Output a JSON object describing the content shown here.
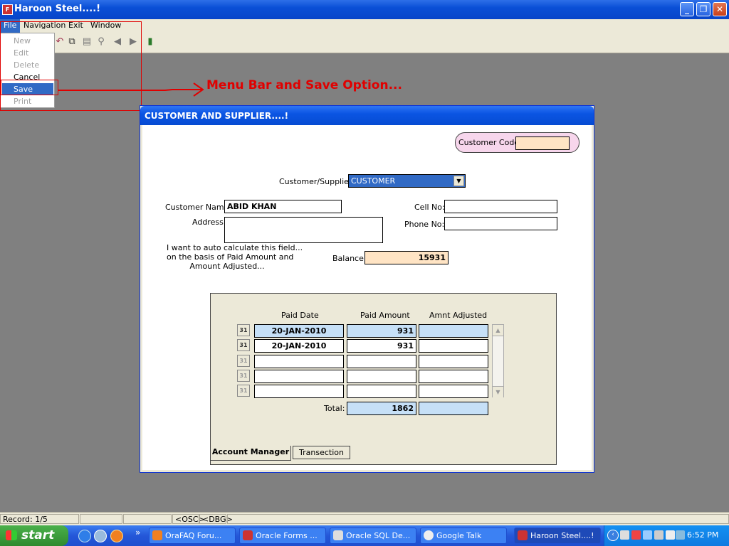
{
  "window": {
    "title": "Haroon Steel....!"
  },
  "menubar": {
    "items": [
      "File",
      "Navigation",
      "Exit",
      "Window"
    ]
  },
  "file_menu": {
    "items": [
      {
        "label": "New",
        "enabled": false
      },
      {
        "label": "Edit",
        "enabled": false
      },
      {
        "label": "Delete",
        "enabled": false
      },
      {
        "label": "Cancel",
        "enabled": true
      },
      {
        "label": "Save",
        "enabled": true,
        "selected": true
      },
      {
        "label": "Print",
        "enabled": false
      }
    ]
  },
  "annotation": {
    "text": "Menu Bar and Save Option..."
  },
  "form": {
    "title": "CUSTOMER AND SUPPLIER....!",
    "customer_code": {
      "label": "Customer Code:",
      "value": ""
    },
    "type": {
      "label": "Customer/Supplier:",
      "value": "CUSTOMER"
    },
    "customer_name": {
      "label": "Customer Name:",
      "value": "ABID KHAN"
    },
    "address": {
      "label": "Address:",
      "value": ""
    },
    "cell_no": {
      "label": "Cell No:",
      "value": ""
    },
    "phone_no": {
      "label": "Phone No:",
      "value": ""
    },
    "note": {
      "line1": "I want to auto calculate this field...",
      "line2": "on the basis of Paid Amount and",
      "line3": "Amount Adjusted..."
    },
    "balance": {
      "label": "Balance:",
      "value": "15931"
    },
    "grid": {
      "headers": [
        "Paid Date",
        "Paid Amount",
        "Amnt Adjusted"
      ],
      "rows": [
        {
          "date": "20-JAN-2010",
          "amount": "931",
          "adjusted": ""
        },
        {
          "date": "20-JAN-2010",
          "amount": "931",
          "adjusted": ""
        },
        {
          "date": "",
          "amount": "",
          "adjusted": ""
        },
        {
          "date": "",
          "amount": "",
          "adjusted": ""
        },
        {
          "date": "",
          "amount": "",
          "adjusted": ""
        }
      ],
      "total_label": "Total:",
      "total_amount": "1862",
      "total_adjusted": ""
    },
    "tabs": [
      "Account Manager",
      "Transection"
    ],
    "calendar_icon_text": "31"
  },
  "statusbar": {
    "record": "Record: 1/5",
    "osc": "<OSC>",
    "dbg": "<DBG>"
  },
  "taskbar": {
    "start_label": "start",
    "tasks": [
      "OraFAQ Foru...",
      "Oracle Forms ...",
      "Oracle SQL De...",
      "Google Talk",
      "Haroon Steel....!"
    ],
    "clock": "6:52 PM"
  },
  "colors": {
    "accent": "#316ac5",
    "annotation": "#e00000",
    "peach_field": "#ffe4c4",
    "blue_field": "#c6e0f7"
  }
}
